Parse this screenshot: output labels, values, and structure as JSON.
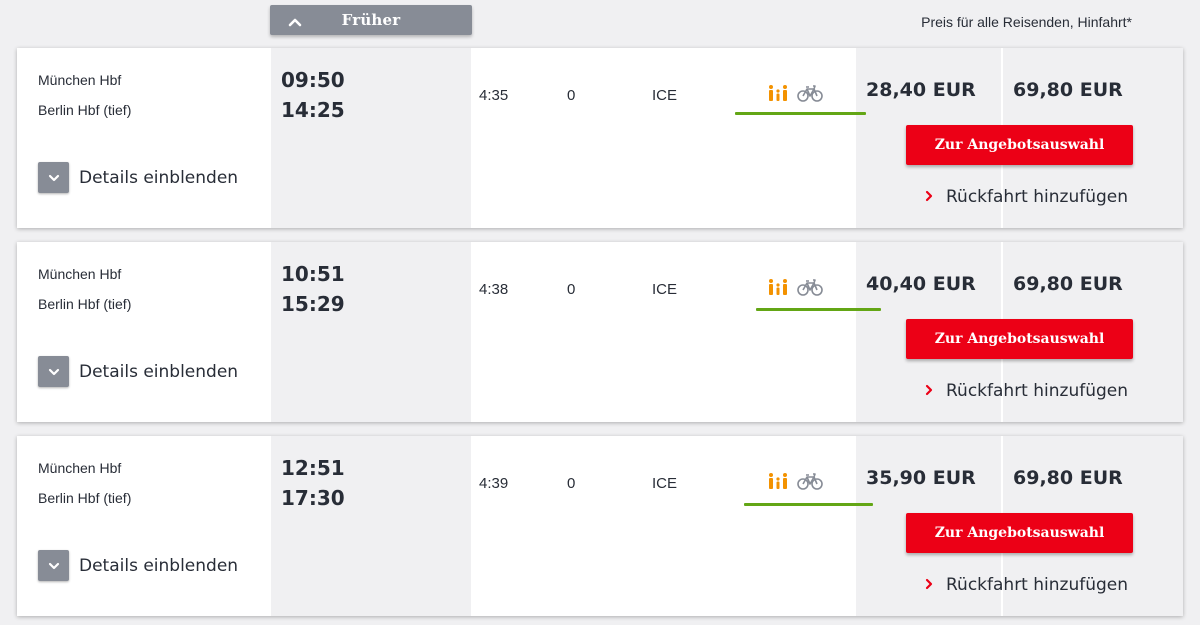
{
  "header": {
    "earlier_label": "Früher",
    "price_note": "Preis für alle Reisenden, Hinfahrt*"
  },
  "colors": {
    "accent_red": "#ec0016",
    "button_gray": "#878c96",
    "green_line": "#63a615",
    "family_icon": "#f39200",
    "bike_icon": "#878c96"
  },
  "connections": [
    {
      "from": "München Hbf",
      "to": "Berlin Hbf (tief)",
      "departure": "09:50",
      "arrival": "14:25",
      "duration": "4:35",
      "changes": "0",
      "product": "ICE",
      "price_saver": "28,40 EUR",
      "price_flex": "69,80 EUR",
      "offer_label": "Zur Angebotsauswahl",
      "return_label": "Rückfahrt hinzufügen",
      "details_label": "Details einblenden",
      "icons": [
        "family-icon",
        "bicycle-icon"
      ]
    },
    {
      "from": "München Hbf",
      "to": "Berlin Hbf (tief)",
      "departure": "10:51",
      "arrival": "15:29",
      "duration": "4:38",
      "changes": "0",
      "product": "ICE",
      "price_saver": "40,40 EUR",
      "price_flex": "69,80 EUR",
      "offer_label": "Zur Angebotsauswahl",
      "return_label": "Rückfahrt hinzufügen",
      "details_label": "Details einblenden",
      "icons": [
        "family-icon",
        "bicycle-icon"
      ]
    },
    {
      "from": "München Hbf",
      "to": "Berlin Hbf (tief)",
      "departure": "12:51",
      "arrival": "17:30",
      "duration": "4:39",
      "changes": "0",
      "product": "ICE",
      "price_saver": "35,90 EUR",
      "price_flex": "69,80 EUR",
      "offer_label": "Zur Angebotsauswahl",
      "return_label": "Rückfahrt hinzufügen",
      "details_label": "Details einblenden",
      "icons": [
        "family-icon",
        "bicycle-icon"
      ]
    }
  ]
}
